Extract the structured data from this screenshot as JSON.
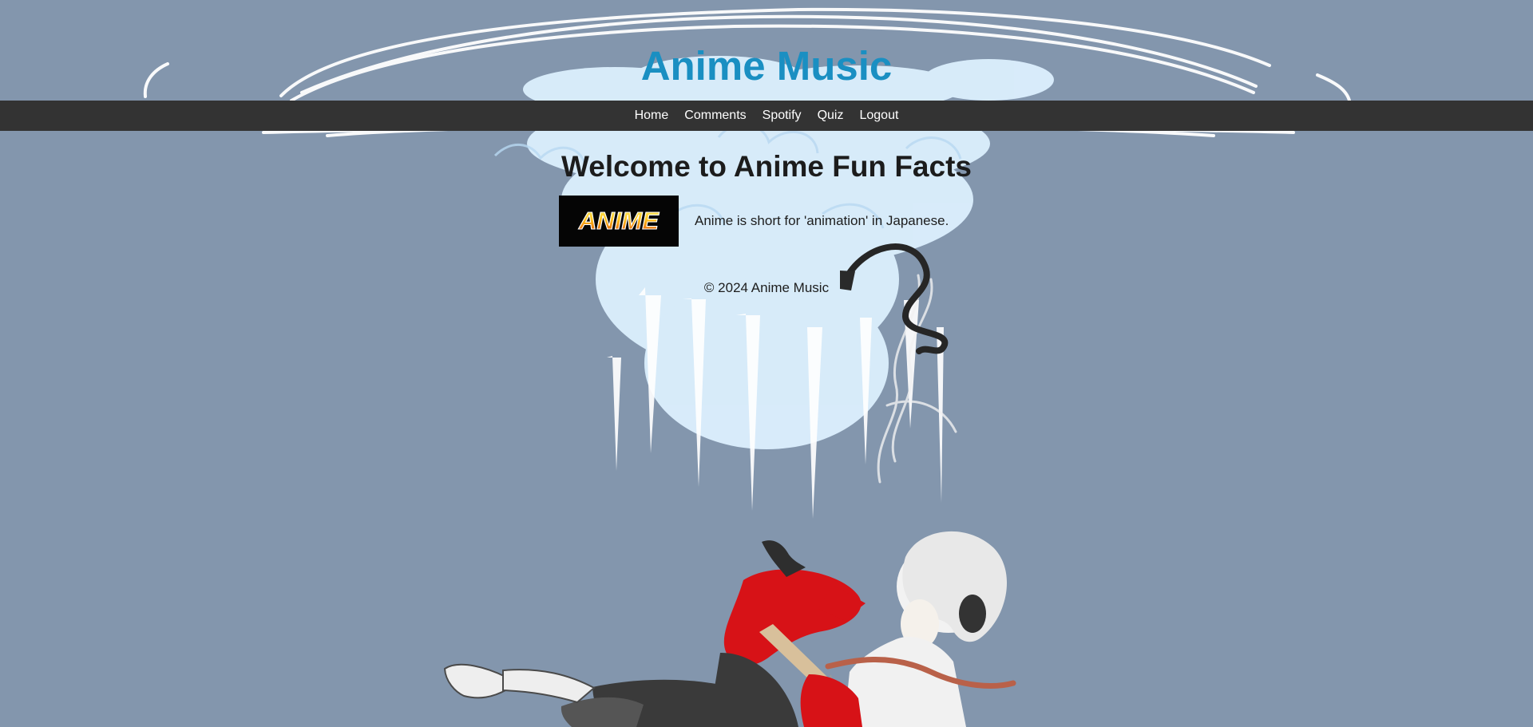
{
  "site": {
    "title": "Anime Music"
  },
  "nav": {
    "items": [
      {
        "label": "Home"
      },
      {
        "label": "Comments"
      },
      {
        "label": "Spotify"
      },
      {
        "label": "Quiz"
      },
      {
        "label": "Logout"
      }
    ]
  },
  "main": {
    "heading": "Welcome to Anime Fun Facts",
    "fact": {
      "image_text": "ANIME",
      "text": "Anime is short for 'animation' in Japanese."
    }
  },
  "footer": {
    "text": "© 2024 Anime Music"
  },
  "colors": {
    "background": "#8396ad",
    "title": "#1a8fc2",
    "nav_background": "#333333",
    "nav_text": "#ffffff",
    "text": "#1d1d1d"
  },
  "background_art": {
    "description_icon": "anime-girl-guitar-illustration"
  }
}
